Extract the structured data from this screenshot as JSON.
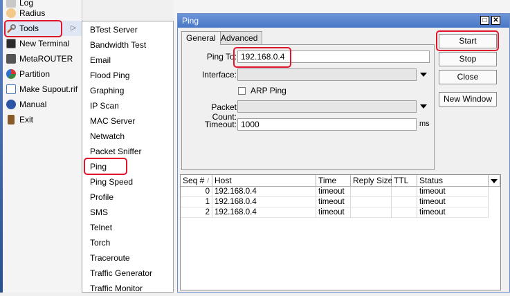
{
  "main_menu": {
    "items": [
      {
        "label": "Log",
        "icon": "log-icon",
        "color": "#c9c9c9"
      },
      {
        "label": "Radius",
        "icon": "radius-icon",
        "color": "#d89a3a"
      },
      {
        "label": "Tools",
        "icon": "tools-icon",
        "color": "#b55b2e"
      },
      {
        "label": "New Terminal",
        "icon": "terminal-icon",
        "color": "#2b2b2b"
      },
      {
        "label": "MetaROUTER",
        "icon": "metarouter-icon",
        "color": "#555"
      },
      {
        "label": "Partition",
        "icon": "partition-icon",
        "color": "#3b8a3b"
      },
      {
        "label": "Make Supout.rif",
        "icon": "supout-icon",
        "color": "#4a7bc8"
      },
      {
        "label": "Manual",
        "icon": "manual-icon",
        "color": "#2e56a6"
      },
      {
        "label": "Exit",
        "icon": "exit-icon",
        "color": "#8a5a2a"
      }
    ]
  },
  "tools_submenu": {
    "items": [
      "BTest Server",
      "Bandwidth Test",
      "Email",
      "Flood Ping",
      "Graphing",
      "IP Scan",
      "MAC Server",
      "Netwatch",
      "Packet Sniffer",
      "Ping",
      "Ping Speed",
      "Profile",
      "SMS",
      "Telnet",
      "Torch",
      "Traceroute",
      "Traffic Generator",
      "Traffic Monitor"
    ]
  },
  "ping_window": {
    "title": "Ping",
    "tabs": [
      "General",
      "Advanced"
    ],
    "form": {
      "ping_to_label": "Ping To:",
      "ping_to_value": "192.168.0.4",
      "interface_label": "Interface:",
      "interface_value": "",
      "arp_ping_label": "ARP Ping",
      "packet_count_label": "Packet Count:",
      "packet_count_value": "",
      "timeout_label": "Timeout:",
      "timeout_value": "1000",
      "timeout_unit": "ms"
    },
    "buttons": {
      "start": "Start",
      "stop": "Stop",
      "close": "Close",
      "new_window": "New Window"
    },
    "table": {
      "columns": [
        "Seq #",
        "Host",
        "Time",
        "Reply Size",
        "TTL",
        "Status"
      ],
      "sort_indicator": "/",
      "rows": [
        {
          "seq": "0",
          "host": "192.168.0.4",
          "time": "timeout",
          "reply_size": "",
          "ttl": "",
          "status": "timeout"
        },
        {
          "seq": "1",
          "host": "192.168.0.4",
          "time": "timeout",
          "reply_size": "",
          "ttl": "",
          "status": "timeout"
        },
        {
          "seq": "2",
          "host": "192.168.0.4",
          "time": "timeout",
          "reply_size": "",
          "ttl": "",
          "status": "timeout"
        }
      ]
    }
  },
  "colors": {
    "highlight": "#e0142b",
    "title_bar": "#5a86d0"
  }
}
